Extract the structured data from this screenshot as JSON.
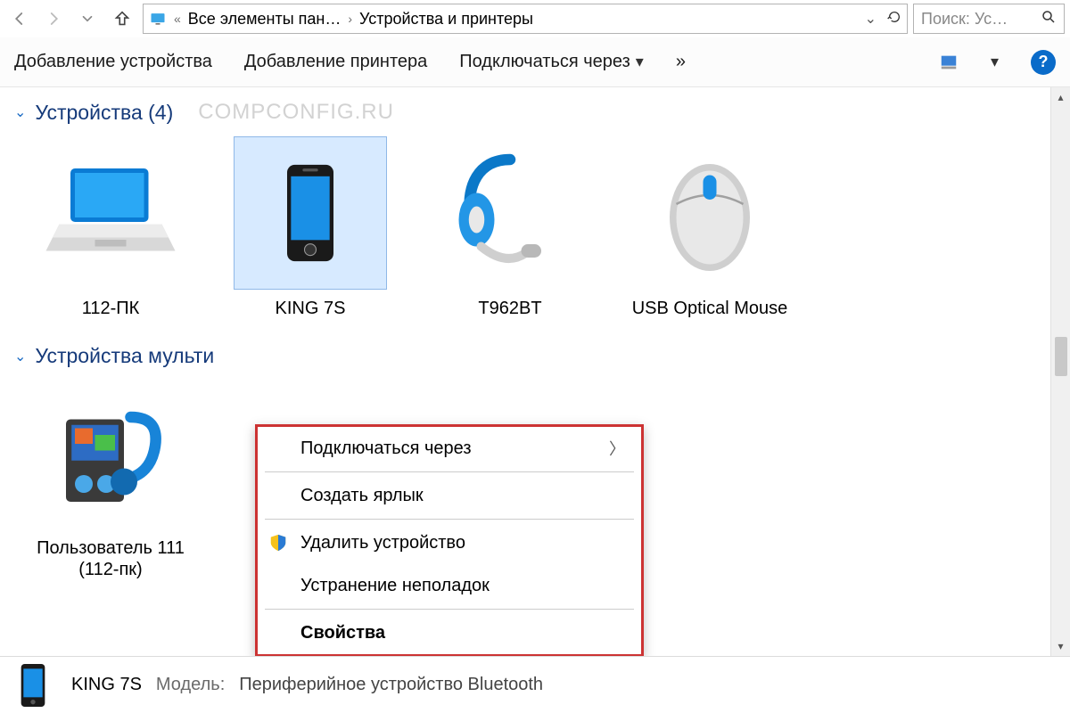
{
  "address": {
    "parent_truncated": "Все элементы пан…",
    "current": "Устройства и принтеры"
  },
  "search": {
    "placeholder": "Поиск: Ус…"
  },
  "toolbar": {
    "add_device": "Добавление устройства",
    "add_printer": "Добавление принтера",
    "connect_via": "Подключаться через",
    "more": "»"
  },
  "groups": [
    {
      "title": "Устройства (4)",
      "watermark": "COMPCONFIG.RU",
      "items": [
        {
          "label": "112-ПК",
          "icon": "laptop-icon",
          "selected": false
        },
        {
          "label": "KING 7S",
          "icon": "smartphone-icon",
          "selected": true
        },
        {
          "label": "T962BT",
          "icon": "bt-headset-icon",
          "selected": false
        },
        {
          "label": "USB Optical Mouse",
          "icon": "mouse-icon",
          "selected": false
        }
      ]
    },
    {
      "title": "Устройства мульти",
      "items": [
        {
          "label": "Пользователь 111 (112-пк)",
          "icon": "media-device-icon",
          "selected": false
        }
      ]
    }
  ],
  "context_menu": {
    "items": [
      {
        "label": "Подключаться через",
        "submenu": true
      },
      {
        "sep": true
      },
      {
        "label": "Создать ярлык"
      },
      {
        "sep": true
      },
      {
        "label": "Удалить устройство",
        "shield": true
      },
      {
        "label": "Устранение неполадок"
      },
      {
        "sep": true
      },
      {
        "label": "Свойства",
        "bold": true
      }
    ]
  },
  "details": {
    "name": "KING 7S",
    "model_label": "Модель:",
    "model_value": "Периферийное устройство Bluetooth"
  }
}
